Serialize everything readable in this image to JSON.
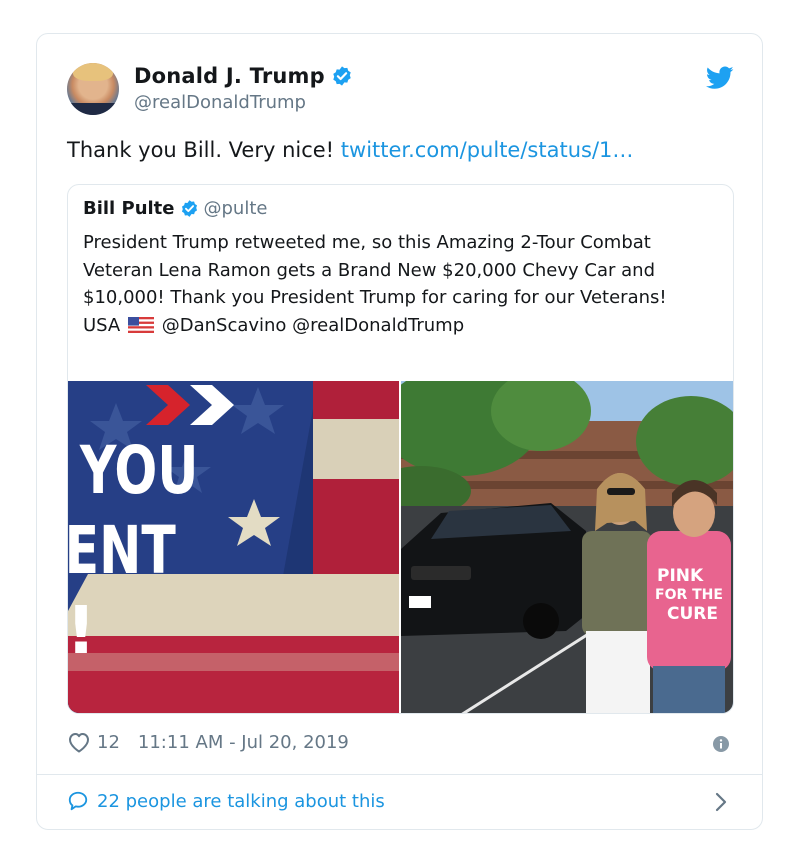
{
  "tweet": {
    "author_name": "Donald J. Trump",
    "author_handle": "@realDonaldTrump",
    "text": "Thank you Bill. Very nice!",
    "link_text": "twitter.com/pulte/status/1…",
    "likes": "12",
    "timestamp": "11:11 AM - Jul 20, 2019",
    "conversation": "22 people are talking about this"
  },
  "quoted": {
    "author_name": "Bill Pulte",
    "author_handle": "@pulte",
    "text_before_flag": "President Trump retweeted me, so this Amazing 2-Tour Combat Veteran Lena Ramon gets a Brand New $20,000 Chevy Car and $10,000! Thank you President Trump for caring for our Veterans! USA",
    "text_after_flag": "@DanScavino @realDonaldTrump"
  },
  "media": {
    "left_image_text": [
      "YOU",
      "ENT",
      "!"
    ],
    "shirt_text": [
      "PINK",
      "FOR THE",
      "CURE"
    ]
  },
  "colors": {
    "verified": "#1da1f2",
    "link": "#1b95e0",
    "secondary_text": "#657786",
    "border": "#e1e8ed"
  },
  "icons": [
    "verified-badge-icon",
    "twitter-bird-icon",
    "heart-icon",
    "info-icon",
    "comment-bubble-icon",
    "chevron-right-icon",
    "us-flag-emoji-icon"
  ]
}
